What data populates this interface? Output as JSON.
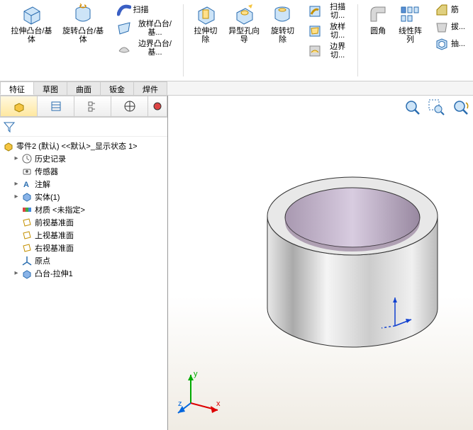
{
  "ribbon": {
    "extrudeBoss": "拉伸凸台/基体",
    "revolveBoss": "旋转凸台/基体",
    "sweep": "扫描",
    "loftBoss": "放样凸台/基...",
    "boundaryBoss": "边界凸台/基...",
    "extrudeCut": "拉伸切除",
    "holeWizard": "异型孔向导",
    "revolveCut": "旋转切除",
    "sweepCut": "扫描切...",
    "loftCut": "放样切...",
    "boundaryCut": "边界切...",
    "fillet": "圆角",
    "linearPattern": "线性阵列",
    "rib": "筋",
    "draft": "拔...",
    "shell": "抽..."
  },
  "tabs": {
    "features": "特征",
    "sketch": "草图",
    "surface": "曲面",
    "sheetMetal": "钣金",
    "weldment": "焊件"
  },
  "tree": {
    "root": "零件2 (默认) <<默认>_显示状态 1>",
    "history": "历史记录",
    "sensors": "传感器",
    "annotations": "注解",
    "solidBodies": "实体(1)",
    "material": "材质 <未指定>",
    "frontPlane": "前视基准面",
    "topPlane": "上视基准面",
    "rightPlane": "右视基准面",
    "origin": "原点",
    "bossExtrude1": "凸台-拉伸1"
  },
  "axes": {
    "x": "x",
    "y": "y",
    "z": "z"
  }
}
